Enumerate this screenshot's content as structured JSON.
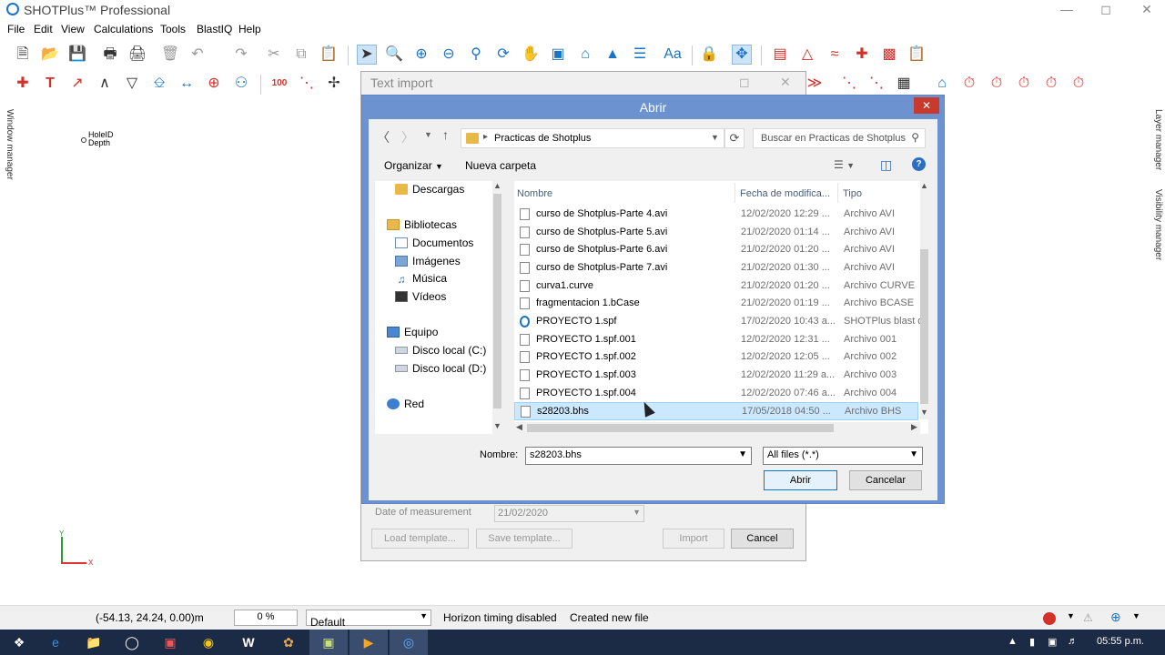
{
  "app": {
    "title": "SHOTPlus™ Professional",
    "menu": [
      "File",
      "Edit",
      "View",
      "Calculations",
      "Tools",
      "BlastIQ",
      "Help"
    ]
  },
  "side": {
    "left_label": "Window manager",
    "right_label_1": "Layer manager",
    "right_label_2": "Visibility manager"
  },
  "canvas": {
    "hole_label_1": "HoleID",
    "hole_label_2": "Depth",
    "axis_y": "Y",
    "axis_x": "X"
  },
  "text_import": {
    "title": "Text import",
    "date_label": "Date of measurement",
    "date_value": "21/02/2020",
    "load_template": "Load template...",
    "save_template": "Save template...",
    "import": "Import",
    "cancel": "Cancel"
  },
  "abrir": {
    "title": "Abrir",
    "path": "Practicas de Shotplus",
    "search_placeholder": "Buscar en Practicas de Shotplus",
    "organizar": "Organizar",
    "nueva_carpeta": "Nueva carpeta",
    "nav": {
      "descargas": "Descargas",
      "bibliotecas": "Bibliotecas",
      "documentos": "Documentos",
      "imagenes": "Imágenes",
      "musica": "Música",
      "videos": "Vídeos",
      "equipo": "Equipo",
      "disco_c": "Disco local (C:)",
      "disco_d": "Disco local (D:)",
      "red": "Red"
    },
    "columns": {
      "name": "Nombre",
      "date": "Fecha de modifica...",
      "type": "Tipo"
    },
    "files": [
      {
        "name": "curso de Shotplus-Parte 4.avi",
        "date": "12/02/2020 12:29 ...",
        "type": "Archivo AVI"
      },
      {
        "name": "curso de Shotplus-Parte 5.avi",
        "date": "21/02/2020 01:14 ...",
        "type": "Archivo AVI"
      },
      {
        "name": "curso de Shotplus-Parte 6.avi",
        "date": "21/02/2020 01:20 ...",
        "type": "Archivo AVI"
      },
      {
        "name": "curso de Shotplus-Parte 7.avi",
        "date": "21/02/2020 01:30 ...",
        "type": "Archivo AVI"
      },
      {
        "name": "curva1.curve",
        "date": "21/02/2020 01:20 ...",
        "type": "Archivo CURVE"
      },
      {
        "name": "fragmentacion 1.bCase",
        "date": "21/02/2020 01:19 ...",
        "type": "Archivo BCASE"
      },
      {
        "name": "PROYECTO 1.spf",
        "date": "17/02/2020 10:43 a...",
        "type": "SHOTPlus blast d"
      },
      {
        "name": "PROYECTO 1.spf.001",
        "date": "12/02/2020 12:31 ...",
        "type": "Archivo 001"
      },
      {
        "name": "PROYECTO 1.spf.002",
        "date": "12/02/2020 12:05 ...",
        "type": "Archivo 002"
      },
      {
        "name": "PROYECTO 1.spf.003",
        "date": "12/02/2020 11:29 a...",
        "type": "Archivo 003"
      },
      {
        "name": "PROYECTO 1.spf.004",
        "date": "12/02/2020 07:46 a...",
        "type": "Archivo 004"
      },
      {
        "name": "s28203.bhs",
        "date": "17/05/2018 04:50 ...",
        "type": "Archivo BHS"
      }
    ],
    "nombre_label": "Nombre:",
    "nombre_value": "s28203.bhs",
    "filter": "All files (*.*)",
    "abrir_btn": "Abrir",
    "cancelar_btn": "Cancelar"
  },
  "status": {
    "coords": "(-54.13, 24.24, 0.00)m",
    "percent": "0 %",
    "layer": "Default",
    "horizon": "Horizon timing disabled",
    "message": "Created new file"
  },
  "taskbar": {
    "time": "05:55 p.m."
  }
}
